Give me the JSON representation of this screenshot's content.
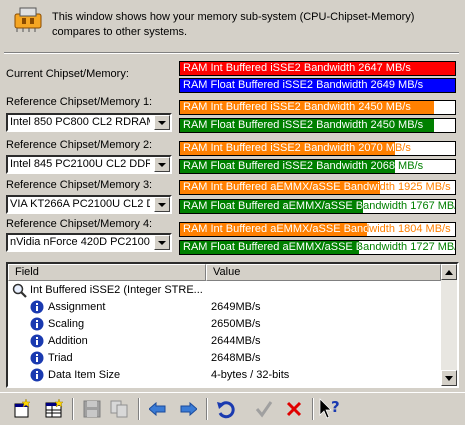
{
  "header": {
    "description": "This window shows how your memory sub-system (CPU-Chipset-Memory) compares to other systems."
  },
  "current": {
    "label": "Current Chipset/Memory:",
    "bars": [
      {
        "text": "RAM Int Buffered iSSE2 Bandwidth 2647 MB/s",
        "fill_fraction": 1.0,
        "color": "#ff0000"
      },
      {
        "text": "RAM Float Buffered iSSE2 Bandwidth 2649 MB/s",
        "fill_fraction": 1.0,
        "color": "#0000ff"
      }
    ]
  },
  "references": [
    {
      "label": "Reference Chipset/Memory 1:",
      "selected": "Intel 850 PC800 CL2 RDRAM (",
      "bars": [
        {
          "text": "RAM Int Buffered iSSE2 Bandwidth 2450 MB/s",
          "fill_fraction": 0.925,
          "color": "#ff8000"
        },
        {
          "text": "RAM Float Buffered iSSE2 Bandwidth 2450 MB/s",
          "fill_fraction": 0.925,
          "color": "#008000"
        }
      ]
    },
    {
      "label": "Reference Chipset/Memory 2:",
      "selected": "Intel 845 PC2100U CL2 DDR (",
      "bars": [
        {
          "text": "RAM Int Buffered iSSE2 Bandwidth 2070 MB/s",
          "fill_fraction": 0.782,
          "color": "#ff8000"
        },
        {
          "text": "RAM Float Buffered iSSE2 Bandwidth 2068 MB/s",
          "fill_fraction": 0.781,
          "color": "#008000"
        }
      ]
    },
    {
      "label": "Reference Chipset/Memory 3:",
      "selected": "VIA KT266A PC2100U CL2 DD",
      "bars": [
        {
          "text": "RAM Int Buffered aEMMX/aSSE Bandwidth 1925 MB/s",
          "fill_fraction": 0.727,
          "color": "#ff8000"
        },
        {
          "text": "RAM Float Buffered aEMMX/aSSE Bandwidth 1767 MB/s",
          "fill_fraction": 0.667,
          "color": "#008000"
        }
      ]
    },
    {
      "label": "Reference Chipset/Memory 4:",
      "selected": "nVidia nForce 420D PC2100U",
      "bars": [
        {
          "text": "RAM Int Buffered aEMMX/aSSE Bandwidth 1804 MB/s",
          "fill_fraction": 0.681,
          "color": "#ff8000"
        },
        {
          "text": "RAM Float Buffered aEMMX/aSSE Bandwidth 1727 MB/s",
          "fill_fraction": 0.652,
          "color": "#008000"
        }
      ]
    }
  ],
  "list": {
    "columns": [
      "Field",
      "Value"
    ],
    "rows": [
      {
        "field": "Int Buffered iSSE2 (Integer STRE...",
        "value": "",
        "icon": "magnifier-icon",
        "indent": 0
      },
      {
        "field": "Assignment",
        "value": "2649MB/s",
        "icon": "info-icon",
        "indent": 1
      },
      {
        "field": "Scaling",
        "value": "2650MB/s",
        "icon": "info-icon",
        "indent": 1
      },
      {
        "field": "Addition",
        "value": "2644MB/s",
        "icon": "info-icon",
        "indent": 1
      },
      {
        "field": "Triad",
        "value": "2648MB/s",
        "icon": "info-icon",
        "indent": 1
      },
      {
        "field": "Data Item Size",
        "value": "4-bytes / 32-bits",
        "icon": "info-icon",
        "indent": 1
      }
    ]
  },
  "toolbar": {
    "buttons": [
      "new-report-icon",
      "table-report-icon",
      "save-icon",
      "copy-icon",
      "back-arrow-icon",
      "forward-arrow-icon",
      "refresh-icon",
      "ok-check-icon",
      "cancel-x-icon",
      "help-pointer-icon"
    ]
  }
}
